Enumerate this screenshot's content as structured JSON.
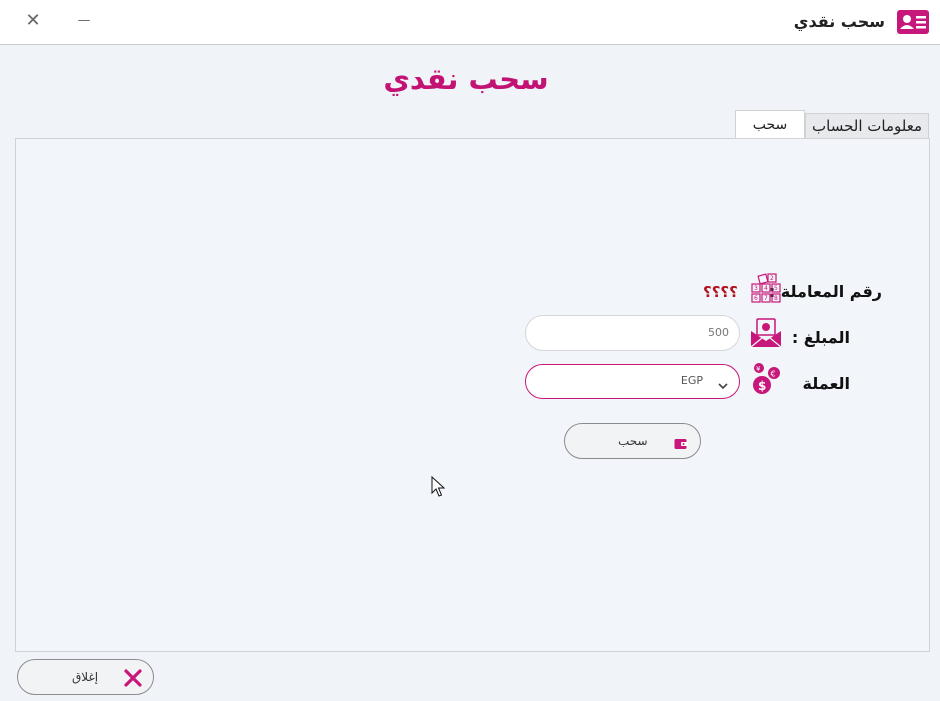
{
  "window": {
    "title": "سحب نقدي",
    "close_glyph": "✕",
    "minimize_glyph": "—"
  },
  "page": {
    "title": "سحب نقدي"
  },
  "tabs": [
    {
      "label": "معلومات الحساب",
      "active": false
    },
    {
      "label": "سحب",
      "active": true
    }
  ],
  "form": {
    "transaction_number": {
      "label": "رقم المعاملة :",
      "value": "؟؟؟؟",
      "icon": "number-blocks-icon"
    },
    "amount": {
      "label": "المبلغ :",
      "value": "500",
      "icon": "money-envelope-icon"
    },
    "currency": {
      "label": "العملة",
      "selected": "EGP",
      "icon": "currency-coins-icon"
    }
  },
  "buttons": {
    "withdraw": {
      "label": "سحب",
      "icon": "wallet-icon"
    },
    "close": {
      "label": "إغلاق",
      "icon": "close-x-icon"
    }
  },
  "colors": {
    "accent": "#c8177a",
    "title": "#c21274",
    "txn_value": "#b0121e"
  }
}
